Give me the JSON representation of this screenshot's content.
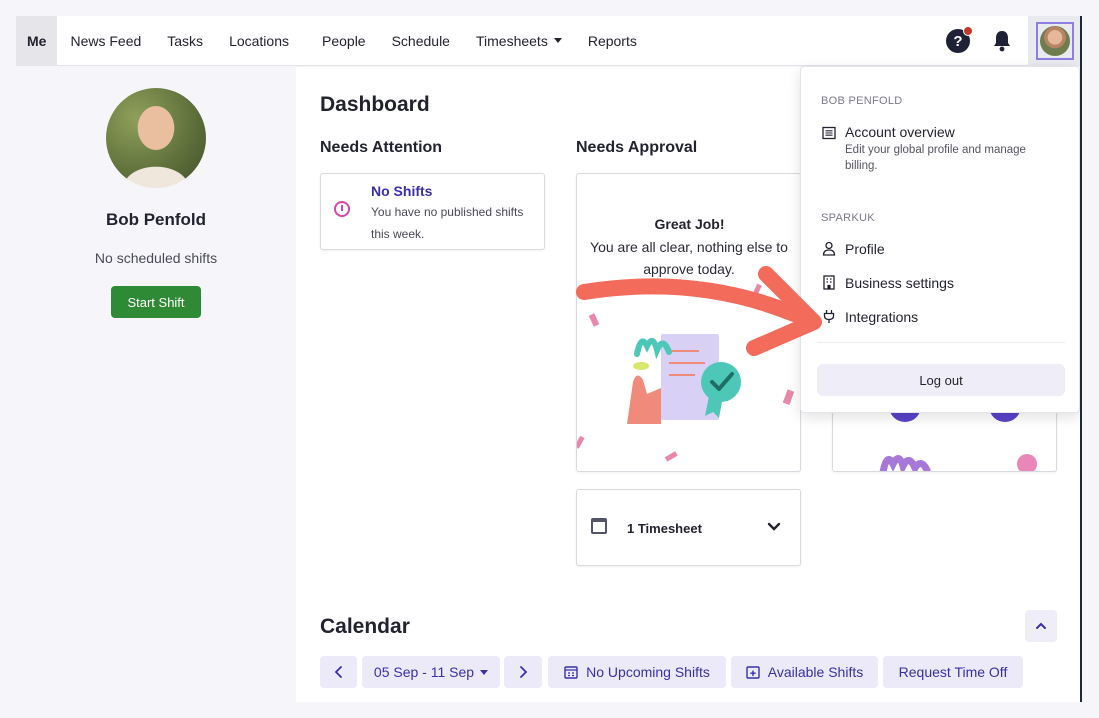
{
  "nav": {
    "items": [
      {
        "label": "Me",
        "active": true
      },
      {
        "label": "News Feed"
      },
      {
        "label": "Tasks"
      },
      {
        "label": "Locations"
      },
      {
        "label": "People"
      },
      {
        "label": "Schedule"
      },
      {
        "label": "Timesheets",
        "has_caret": true
      },
      {
        "label": "Reports"
      }
    ],
    "help_icon": "question-icon",
    "bell_icon": "bell-icon"
  },
  "sidebar": {
    "name": "Bob Penfold",
    "status": "No scheduled shifts",
    "start_shift_label": "Start Shift"
  },
  "dashboard": {
    "title": "Dashboard",
    "needs_attention": {
      "heading": "Needs Attention",
      "card_title": "No Shifts",
      "card_desc": "You have no published shifts this week."
    },
    "needs_approval": {
      "heading": "Needs Approval",
      "title": "Great Job!",
      "message": "You are all clear, nothing else to approve today."
    },
    "timesheet_label": "1 Timesheet"
  },
  "calendar": {
    "title": "Calendar",
    "date_range": "05 Sep - 11 Sep",
    "upcoming_label": "No Upcoming Shifts",
    "available_label": "Available Shifts",
    "time_off_label": "Request Time Off"
  },
  "dropdown": {
    "user_section": "BOB PENFOLD",
    "account_title": "Account overview",
    "account_desc": "Edit your global profile and manage billing.",
    "org_section": "SPARKUK",
    "profile_label": "Profile",
    "business_label": "Business settings",
    "integrations_label": "Integrations",
    "logout_label": "Log out"
  },
  "colors": {
    "accent": "#3a2fa8",
    "start_shift": "#2f8a35",
    "arrow": "#f26b5b",
    "clock": "#d548a8"
  }
}
